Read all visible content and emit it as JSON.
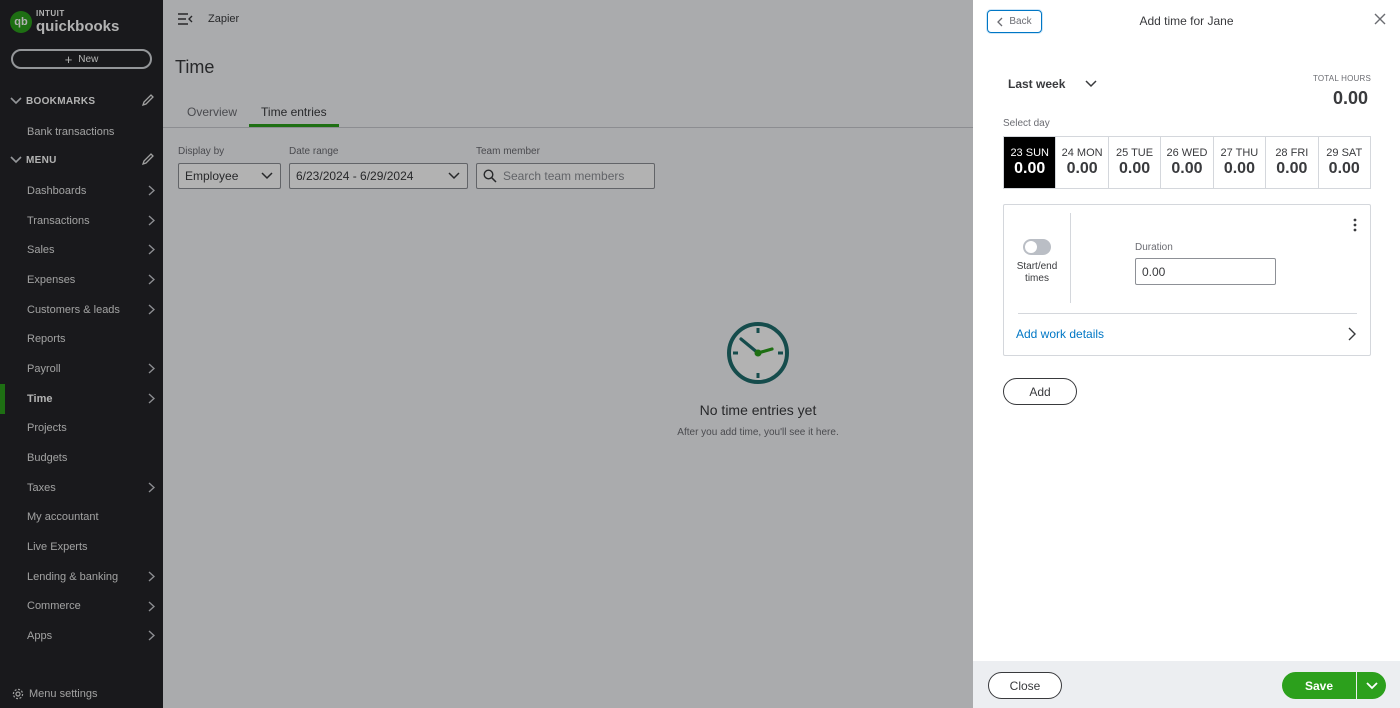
{
  "brand": {
    "intuit": "INTUIT",
    "product": "quickbooks",
    "badge": "qb"
  },
  "sidebar": {
    "new_label": "New",
    "bookmarks_label": "BOOKMARKS",
    "bookmark_items": [
      "Bank transactions"
    ],
    "menu_label": "MENU",
    "items": [
      {
        "label": "Dashboards",
        "has_chevron": true
      },
      {
        "label": "Transactions",
        "has_chevron": true
      },
      {
        "label": "Sales",
        "has_chevron": true
      },
      {
        "label": "Expenses",
        "has_chevron": true
      },
      {
        "label": "Customers & leads",
        "has_chevron": true
      },
      {
        "label": "Reports",
        "has_chevron": false
      },
      {
        "label": "Payroll",
        "has_chevron": true
      },
      {
        "label": "Time",
        "has_chevron": true,
        "active": true
      },
      {
        "label": "Projects",
        "has_chevron": false
      },
      {
        "label": "Budgets",
        "has_chevron": false
      },
      {
        "label": "Taxes",
        "has_chevron": true
      },
      {
        "label": "My accountant",
        "has_chevron": false
      },
      {
        "label": "Live Experts",
        "has_chevron": false
      },
      {
        "label": "Lending & banking",
        "has_chevron": true
      },
      {
        "label": "Commerce",
        "has_chevron": true
      },
      {
        "label": "Apps",
        "has_chevron": true
      }
    ],
    "settings_label": "Menu settings"
  },
  "header": {
    "company": "Zapier"
  },
  "page": {
    "title": "Time",
    "tabs": [
      {
        "label": "Overview"
      },
      {
        "label": "Time entries",
        "active": true
      }
    ],
    "filters": {
      "display_by_label": "Display by",
      "display_by_value": "Employee",
      "date_range_label": "Date range",
      "date_range_value": "6/23/2024 - 6/29/2024",
      "team_member_label": "Team member",
      "search_placeholder": "Search team members"
    },
    "empty": {
      "title": "No time entries yet",
      "subtitle": "After you add time, you'll see it here."
    }
  },
  "drawer": {
    "back_label": "Back",
    "title": "Add time for Jane",
    "week_label": "Last week",
    "total_label": "TOTAL HOURS",
    "total_value": "0.00",
    "select_day_label": "Select day",
    "days": [
      {
        "label": "23 SUN",
        "value": "0.00",
        "selected": true
      },
      {
        "label": "24 MON",
        "value": "0.00"
      },
      {
        "label": "25 TUE",
        "value": "0.00"
      },
      {
        "label": "26 WED",
        "value": "0.00"
      },
      {
        "label": "27 THU",
        "value": "0.00"
      },
      {
        "label": "28 FRI",
        "value": "0.00"
      },
      {
        "label": "29 SAT",
        "value": "0.00"
      }
    ],
    "toggle_label": "Start/end times",
    "duration_label": "Duration",
    "duration_value": "0.00",
    "work_details_label": "Add work details",
    "add_label": "Add",
    "close_label": "Close",
    "save_label": "Save"
  },
  "colors": {
    "brand_green": "#2ca01c",
    "link_blue": "#0077c5",
    "sidebar_bg": "#242529",
    "clock_teal": "#1f6e6e"
  }
}
